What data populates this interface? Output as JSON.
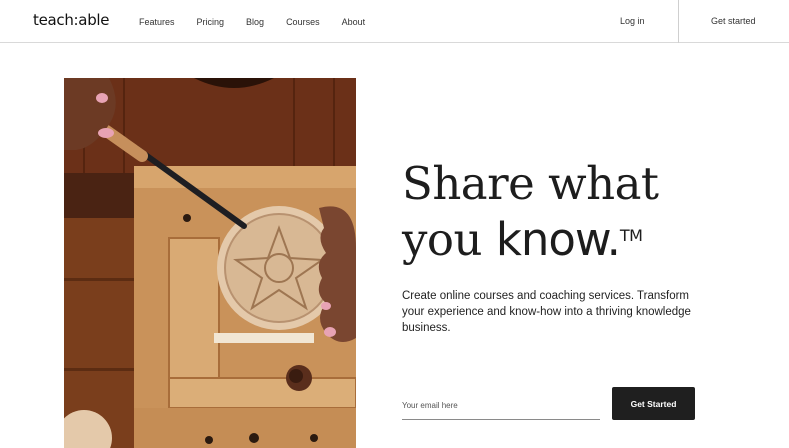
{
  "nav": {
    "logo": "teach:able",
    "links": [
      "Features",
      "Pricing",
      "Blog",
      "Courses",
      "About"
    ],
    "login": "Log in",
    "get_started": "Get started"
  },
  "hero": {
    "headline_line1": "Share what",
    "headline_line2_light": "you ",
    "headline_line2_bold": "know.",
    "trademark": "TM",
    "subtext": "Create online courses and coaching services. Transform your experience and know-how into a thriving knowledge business.",
    "email_placeholder": "Your email here",
    "cta_label": "Get Started"
  },
  "colors": {
    "cta_bg": "#1f1f1f",
    "text": "#1c1c1c"
  }
}
